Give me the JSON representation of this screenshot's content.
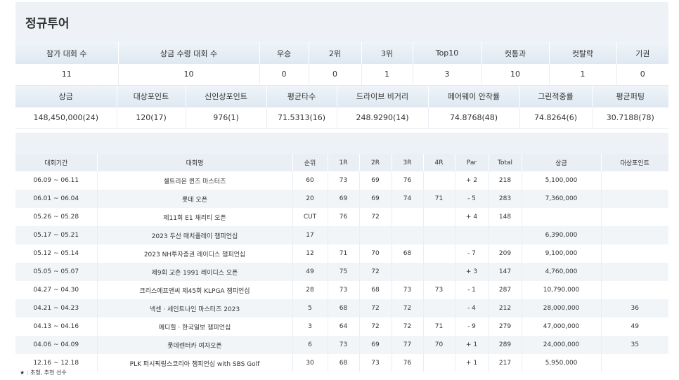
{
  "title": "정규투어",
  "stats1": {
    "headers": [
      "참가 대회 수",
      "상금 수령 대회 수",
      "우승",
      "2위",
      "3위",
      "Top10",
      "컷통과",
      "컷탈락",
      "기권"
    ],
    "values": [
      "11",
      "10",
      "0",
      "0",
      "1",
      "3",
      "10",
      "1",
      "0"
    ]
  },
  "stats2": {
    "headers": [
      "상금",
      "대상포인트",
      "신인상포인트",
      "평균타수",
      "드라이브 비거리",
      "페어웨이 안착률",
      "그린적중률",
      "평균퍼팅"
    ],
    "values": [
      "148,450,000(24)",
      "120(17)",
      "976(1)",
      "71.5313(16)",
      "248.9290(14)",
      "74.8768(48)",
      "74.8264(6)",
      "30.7188(78)"
    ]
  },
  "results": {
    "headers": [
      "대회기간",
      "대회명",
      "순위",
      "1R",
      "2R",
      "3R",
      "4R",
      "Par",
      "Total",
      "상금",
      "대상포인트"
    ],
    "rows": [
      [
        "06.09 ~ 06.11",
        "셀트리온 퀸즈 마스터즈",
        "60",
        "73",
        "69",
        "76",
        "",
        "+ 2",
        "218",
        "5,100,000",
        ""
      ],
      [
        "06.01 ~ 06.04",
        "롯데 오픈",
        "20",
        "69",
        "69",
        "74",
        "71",
        "- 5",
        "283",
        "7,360,000",
        ""
      ],
      [
        "05.26 ~ 05.28",
        "제11회 E1 채리티 오픈",
        "CUT",
        "76",
        "72",
        "",
        "",
        "+ 4",
        "148",
        "",
        ""
      ],
      [
        "05.17 ~ 05.21",
        "2023 두산 매치플레이 챔피언십",
        "17",
        "",
        "",
        "",
        "",
        "",
        "",
        "6,390,000",
        ""
      ],
      [
        "05.12 ~ 05.14",
        "2023 NH투자증권 레이디스 챔피언십",
        "12",
        "71",
        "70",
        "68",
        "",
        "- 7",
        "209",
        "9,100,000",
        ""
      ],
      [
        "05.05 ~ 05.07",
        "제9회 교촌 1991 레이디스 오픈",
        "49",
        "75",
        "72",
        "",
        "",
        "+ 3",
        "147",
        "4,760,000",
        ""
      ],
      [
        "04.27 ~ 04.30",
        "크리스에프앤씨 제45회 KLPGA 챔피언십",
        "28",
        "73",
        "68",
        "73",
        "73",
        "- 1",
        "287",
        "10,790,000",
        ""
      ],
      [
        "04.21 ~ 04.23",
        "넥센 · 세인트나인 마스터즈 2023",
        "5",
        "68",
        "72",
        "72",
        "",
        "- 4",
        "212",
        "28,000,000",
        "36"
      ],
      [
        "04.13 ~ 04.16",
        "메디힐 · 한국일보 챔피언십",
        "3",
        "64",
        "72",
        "72",
        "71",
        "- 9",
        "279",
        "47,000,000",
        "49"
      ],
      [
        "04.06 ~ 04.09",
        "롯데렌터카 여자오픈",
        "6",
        "73",
        "69",
        "77",
        "70",
        "+ 1",
        "289",
        "24,000,000",
        "35"
      ],
      [
        "12.16 ~ 12.18",
        "PLK 퍼시픽링스코리아 챔피언십 with SBS Golf",
        "30",
        "68",
        "73",
        "76",
        "",
        "+ 1",
        "217",
        "5,950,000",
        ""
      ]
    ]
  },
  "footnote": "★ : 초청, 추천 선수"
}
